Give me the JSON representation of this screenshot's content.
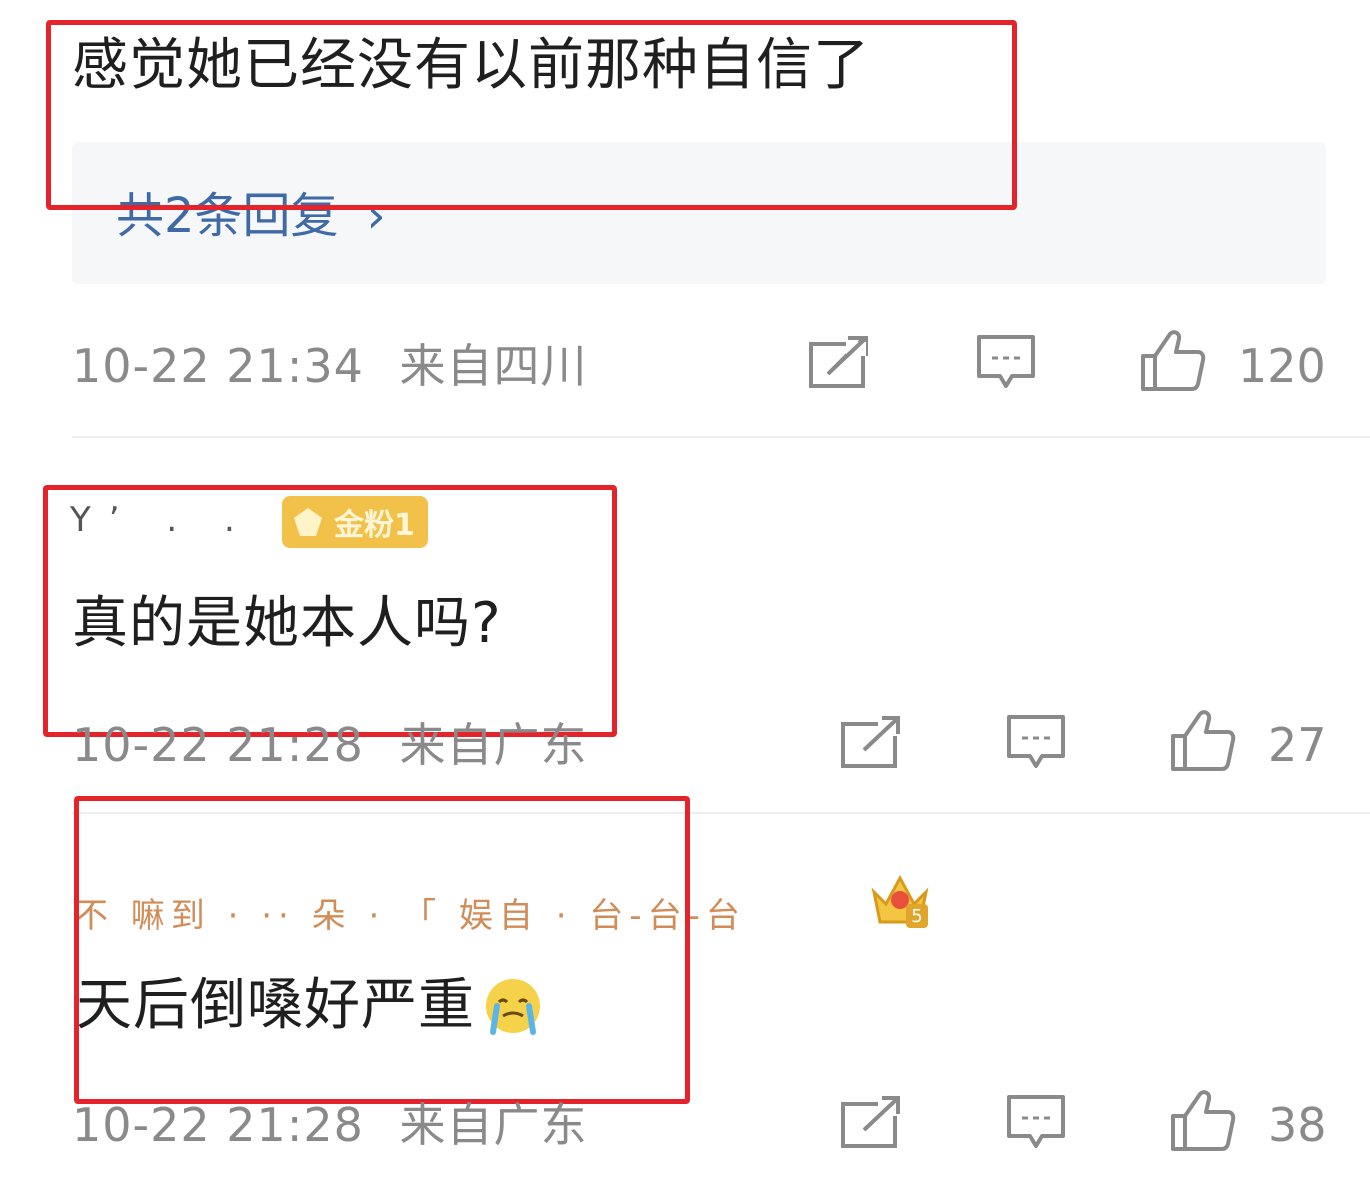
{
  "comments": [
    {
      "text": "感觉她已经没有以前那种自信了",
      "replies_label": "共2条回复",
      "replies_chevron": "›",
      "timestamp": "10-22 21:34",
      "location": "来自四川",
      "likes": "120",
      "icons": [
        "share-icon",
        "comment-icon",
        "like-icon"
      ]
    },
    {
      "username": "Y’ . .  ..",
      "badge": "金粉1",
      "text": "真的是她本人吗?",
      "timestamp": "10-22 21:28",
      "location": "来自广东",
      "likes": "27",
      "icons": [
        "share-icon",
        "comment-icon",
        "like-icon"
      ]
    },
    {
      "username": "不 嘛到 · ·· 朵 · 「 娱自 · 台-台-台",
      "emoji": "😢",
      "text": "天后倒嗓好严重",
      "timestamp": "10-22 21:28",
      "location": "来自广东",
      "likes": "38",
      "icons": [
        "share-icon",
        "comment-icon",
        "like-icon"
      ]
    }
  ],
  "colors": {
    "highlight": "#e5232b",
    "link": "#3f6aa8",
    "meta": "#8a8a8a",
    "badge": "#f2c14a"
  }
}
